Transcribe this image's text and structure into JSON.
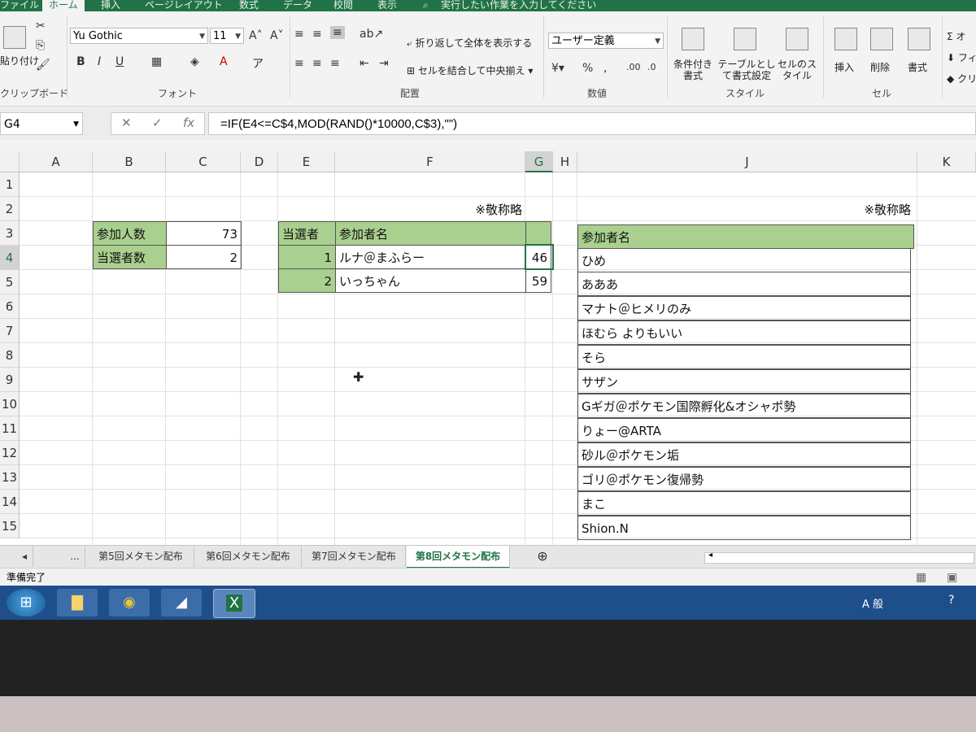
{
  "ribbon": {
    "tabs": [
      "ファイル",
      "ホーム",
      "挿入",
      "ページレイアウト",
      "数式",
      "データ",
      "校閲",
      "表示"
    ],
    "tell_me": "実行したい作業を入力してください",
    "clipboard": {
      "paste_label": "貼り付け",
      "group_label": "クリップボード"
    },
    "font": {
      "name": "Yu Gothic",
      "size": "11",
      "group_label": "フォント",
      "bold": "B",
      "italic": "I",
      "underline": "U"
    },
    "alignment": {
      "wrap_label": "折り返して全体を表示する",
      "merge_label": "セルを結合して中央揃え",
      "group_label": "配置"
    },
    "number": {
      "format": "ユーザー定義",
      "group_label": "数値"
    },
    "styles": {
      "cond_label": "条件付き書式",
      "table_label": "テーブルとして書式設定",
      "cell_style_label": "セルのスタイル",
      "group_label": "スタイル"
    },
    "cells": {
      "insert_label": "挿入",
      "delete_label": "削除",
      "format_label": "書式",
      "group_label": "セル"
    },
    "editing": {
      "sum_label": "オ",
      "fill_label": "フィ",
      "clear_label": "クリ"
    }
  },
  "formula_bar": {
    "name_box": "G4",
    "formula": "=IF(E4<=C$4,MOD(RAND()*10000,C$3),\"\")"
  },
  "grid": {
    "columns": [
      "A",
      "B",
      "C",
      "D",
      "E",
      "F",
      "G",
      "H",
      "J",
      "K"
    ],
    "rows": [
      "1",
      "2",
      "3",
      "4",
      "5",
      "6",
      "7",
      "8",
      "9",
      "10",
      "11",
      "12",
      "13",
      "14",
      "15"
    ],
    "note_f2": "※敬称略",
    "note_j2": "※敬称略",
    "summary": {
      "participants_label": "参加人数",
      "participants_value": "73",
      "winners_label": "当選者数",
      "winners_value": "2"
    },
    "winners_table": {
      "header_no": "当選者",
      "header_name": "参加者名",
      "rows": [
        {
          "no": "1",
          "name": "ルナ＠まふらー",
          "g": "46"
        },
        {
          "no": "2",
          "name": "いっちゃん",
          "g": "59"
        }
      ]
    },
    "participants_table": {
      "header": "参加者名",
      "names": [
        "ひめ",
        "あああ",
        "マナト＠ヒメリのみ",
        "ほむら よりもいい",
        "そら",
        "サザン",
        "Gギガ＠ポケモン国際孵化&オシャポ勢",
        "りょー@ARTA",
        "砂ル＠ポケモン垢",
        "ゴリ＠ポケモン復帰勢",
        "まこ",
        "Shion.N"
      ]
    }
  },
  "sheet_tabs": {
    "ellipsis": "...",
    "tabs": [
      "第5回メタモン配布",
      "第6回メタモン配布",
      "第7回メタモン配布",
      "第8回メタモン配布"
    ],
    "active": "第8回メタモン配布"
  },
  "status": {
    "ready": "準備完了"
  },
  "taskbar": {
    "ime": "A 般"
  },
  "colors": {
    "excel_green": "#217346",
    "cell_green": "#a9d08e",
    "taskbar": "#1e4f8a"
  }
}
